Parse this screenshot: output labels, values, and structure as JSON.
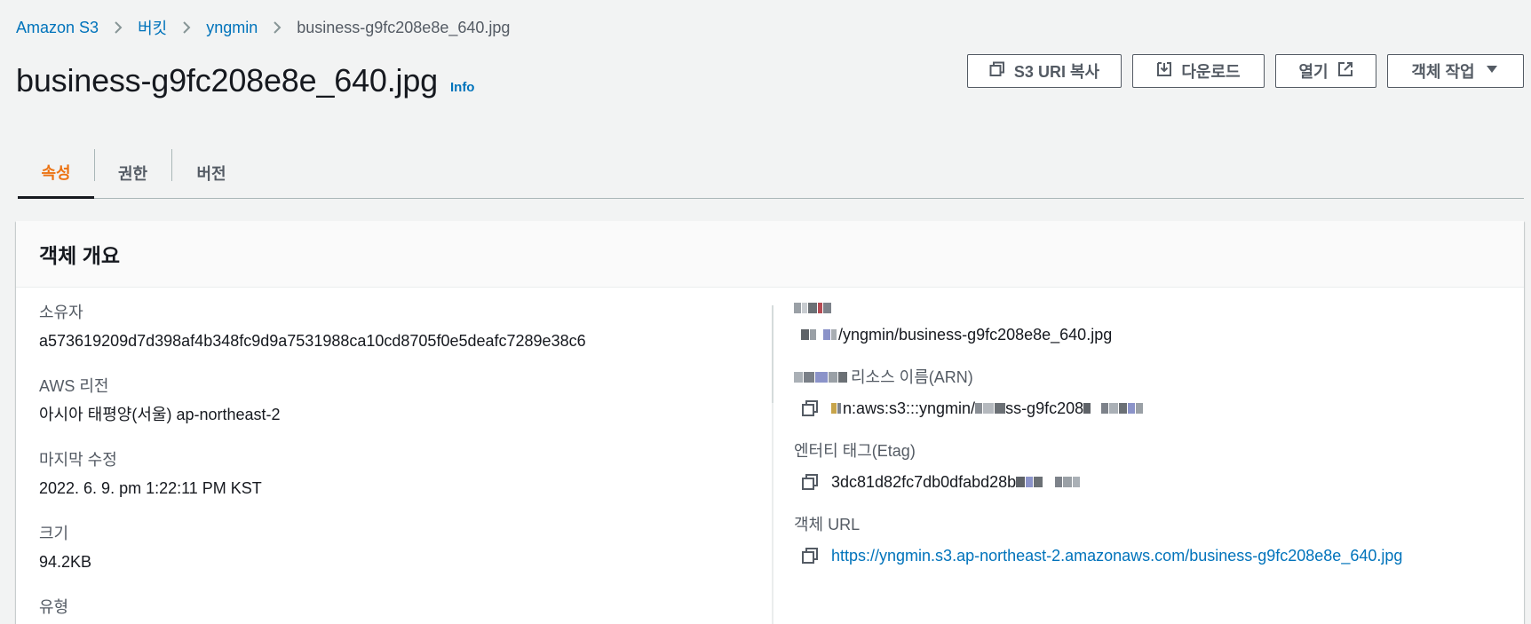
{
  "breadcrumb": {
    "items": [
      "Amazon S3",
      "버킷",
      "yngmin",
      "business-g9fc208e8e_640.jpg"
    ]
  },
  "header": {
    "title": "business-g9fc208e8e_640.jpg",
    "info": "Info"
  },
  "actions": {
    "copy_uri": "S3 URI 복사",
    "download": "다운로드",
    "open": "열기",
    "object_actions": "객체 작업"
  },
  "tabs": [
    "속성",
    "권한",
    "버전"
  ],
  "overview": {
    "title": "객체 개요",
    "left": [
      {
        "label": "소유자",
        "value": "a573619209d7d398af4b348fc9d9a7531988ca10cd8705f0e5deafc7289e38c6"
      },
      {
        "label": "AWS 리전",
        "value": "아시아 태평양(서울) ap-northeast-2"
      },
      {
        "label": "마지막 수정",
        "value": "2022. 6. 9. pm 1:22:11 PM KST"
      },
      {
        "label": "크기",
        "value": "94.2KB"
      },
      {
        "label": "유형",
        "value": ""
      }
    ],
    "right": {
      "s3uri_value": "/yngmin/business-g9fc208e8e_640.jpg",
      "arn_label": "리소스 이름(ARN)",
      "arn_value_a": "n:aws:s3:::yngmin/",
      "arn_value_b": "ss-g9fc208",
      "etag_label": "엔터티 태그(Etag)",
      "etag_value": "3dc81d82fc7db0dfabd28b",
      "url_label": "객체 URL",
      "url_value": "https://yngmin.s3.ap-northeast-2.amazonaws.com/business-g9fc208e8e_640.jpg"
    }
  },
  "colors": {
    "link": "#0073bb",
    "active_tab": "#ec7211",
    "background": "#f2f3f3"
  }
}
